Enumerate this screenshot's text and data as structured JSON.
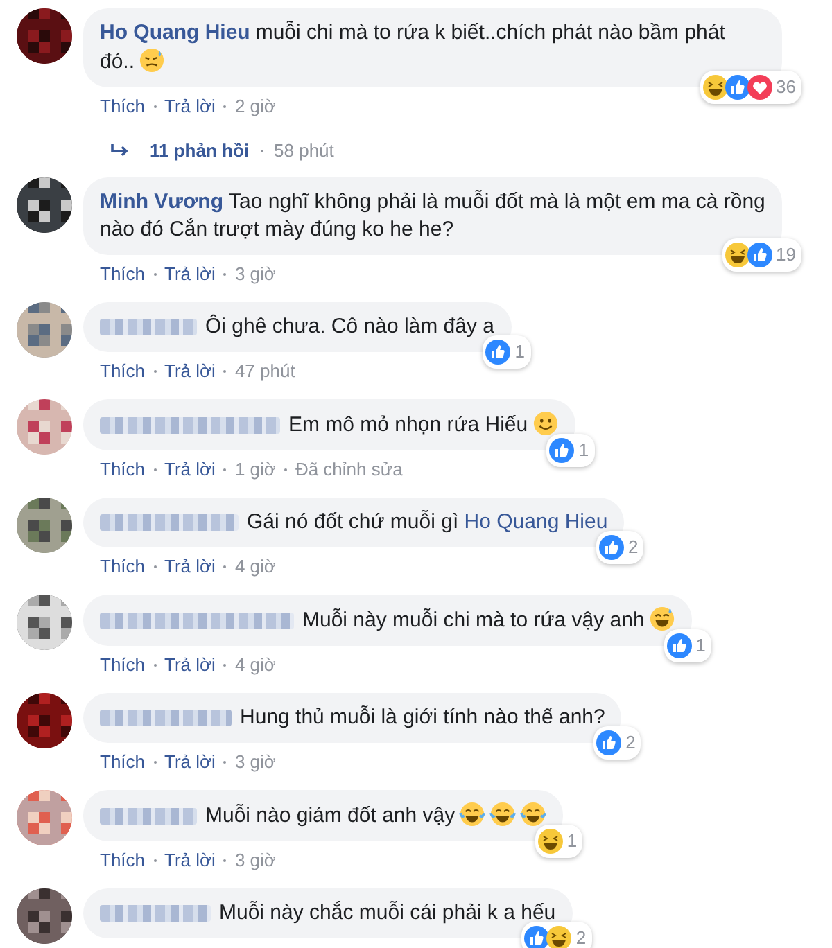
{
  "comments": [
    {
      "avatar": {
        "kind": "picture"
      },
      "name": "Ho Quang Hieu",
      "name_hidden": false,
      "text": "muỗi chi mà to rứa k biết..chích phát nào bầm phát đó..",
      "emojis": [
        {
          "kind": "downcast"
        }
      ],
      "reactions": [
        {
          "kind": "haha"
        },
        {
          "kind": "like"
        },
        {
          "kind": "love"
        }
      ],
      "reaction_count": "36",
      "meta": {
        "like": "Thích",
        "reply": "Trả lời",
        "time": "2 giờ"
      },
      "replies": {
        "count": "11 phản hồi",
        "time": "58 phút"
      }
    },
    {
      "avatar": {
        "kind": "picture"
      },
      "name": "Minh Vương",
      "name_hidden": false,
      "text": "Tao nghĩ không phải là muỗi đốt mà là một em ma cà rồng nào đó Cắn trượt mày đúng ko he he?",
      "reactions": [
        {
          "kind": "haha"
        },
        {
          "kind": "like"
        }
      ],
      "reaction_count": "19",
      "meta": {
        "like": "Thích",
        "reply": "Trả lời",
        "time": "3 giờ"
      }
    },
    {
      "avatar": {
        "kind": "picture"
      },
      "name_hidden": true,
      "text": "Ôi ghê chưa. Cô nào làm đây a",
      "reactions": [
        {
          "kind": "like"
        }
      ],
      "reaction_count": "1",
      "meta": {
        "like": "Thích",
        "reply": "Trả lời",
        "time": "47 phút"
      }
    },
    {
      "avatar": {
        "kind": "picture"
      },
      "name_hidden": true,
      "text": "Em mô mỏ nhọn rứa Hiếu",
      "emojis": [
        {
          "kind": "smile"
        }
      ],
      "reactions": [
        {
          "kind": "like"
        }
      ],
      "reaction_count": "1",
      "meta": {
        "like": "Thích",
        "reply": "Trả lời",
        "time": "1 giờ",
        "edited": "Đã chỉnh sửa"
      }
    },
    {
      "avatar": {
        "kind": "picture"
      },
      "name_hidden": true,
      "text": "Gái nó đốt chứ muỗi gì",
      "mention": "Ho Quang Hieu",
      "reactions": [
        {
          "kind": "like"
        }
      ],
      "reaction_count": "2",
      "meta": {
        "like": "Thích",
        "reply": "Trả lời",
        "time": "4 giờ"
      }
    },
    {
      "avatar": {
        "kind": "picture"
      },
      "name_hidden": true,
      "text": "Muỗi này muỗi chi mà to rứa vậy anh",
      "emojis": [
        {
          "kind": "grin-sweat"
        }
      ],
      "reactions": [
        {
          "kind": "like"
        }
      ],
      "reaction_count": "1",
      "meta": {
        "like": "Thích",
        "reply": "Trả lời",
        "time": "4 giờ"
      }
    },
    {
      "avatar": {
        "kind": "picture"
      },
      "name_hidden": true,
      "text": "Hung thủ muỗi là giới tính nào thế anh?",
      "reactions": [
        {
          "kind": "like"
        }
      ],
      "reaction_count": "2",
      "meta": {
        "like": "Thích",
        "reply": "Trả lời",
        "time": "3 giờ"
      }
    },
    {
      "avatar": {
        "kind": "picture"
      },
      "name_hidden": true,
      "text": "Muỗi nào giám đốt anh vậy",
      "emojis": [
        {
          "kind": "joy"
        },
        {
          "kind": "joy"
        },
        {
          "kind": "joy"
        }
      ],
      "reactions": [
        {
          "kind": "haha"
        }
      ],
      "reaction_count": "1",
      "meta": {
        "like": "Thích",
        "reply": "Trả lời",
        "time": "3 giờ"
      }
    },
    {
      "avatar": {
        "kind": "picture"
      },
      "name_hidden": true,
      "text": "Muỗi này chắc muỗi cái phải k a hếu",
      "reactions": [
        {
          "kind": "like"
        },
        {
          "kind": "haha"
        }
      ],
      "reaction_count": "2"
    }
  ]
}
